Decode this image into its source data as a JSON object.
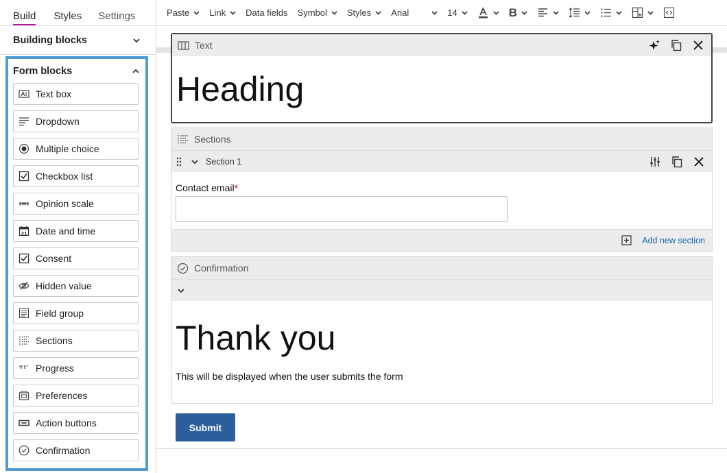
{
  "left_panel": {
    "tabs": [
      {
        "label": "Build",
        "active": true
      },
      {
        "label": "Styles",
        "active": false
      },
      {
        "label": "Settings",
        "active": false
      }
    ],
    "building_blocks": {
      "label": "Building blocks",
      "expanded": false
    },
    "form_blocks": {
      "label": "Form blocks",
      "expanded": true,
      "items": [
        {
          "label": "Text box",
          "icon": "text-box-icon"
        },
        {
          "label": "Dropdown",
          "icon": "dropdown-icon"
        },
        {
          "label": "Multiple choice",
          "icon": "radio-icon"
        },
        {
          "label": "Checkbox list",
          "icon": "checkbox-icon"
        },
        {
          "label": "Opinion scale",
          "icon": "scale-icon"
        },
        {
          "label": "Date and time",
          "icon": "calendar-icon"
        },
        {
          "label": "Consent",
          "icon": "checkbox-icon"
        },
        {
          "label": "Hidden value",
          "icon": "eye-off-icon"
        },
        {
          "label": "Field group",
          "icon": "field-group-icon"
        },
        {
          "label": "Sections",
          "icon": "sections-icon"
        },
        {
          "label": "Progress",
          "icon": "progress-icon"
        },
        {
          "label": "Preferences",
          "icon": "preferences-icon"
        },
        {
          "label": "Action buttons",
          "icon": "button-icon"
        },
        {
          "label": "Confirmation",
          "icon": "check-circle-icon"
        }
      ]
    }
  },
  "toolbar": {
    "paste": "Paste",
    "link": "Link",
    "data_fields": "Data fields",
    "symbol": "Symbol",
    "styles": "Styles",
    "font": "Arial",
    "size": "14"
  },
  "canvas": {
    "text_block": {
      "title": "Text",
      "content": "Heading"
    },
    "sections_block": {
      "title": "Sections",
      "section_name": "Section 1",
      "field_label": "Contact email",
      "required_mark": "*",
      "field_value": "",
      "add_label": "Add new section"
    },
    "confirmation_block": {
      "title": "Confirmation",
      "heading": "Thank you",
      "note": "This will be displayed when the user submits the form"
    },
    "submit_label": "Submit"
  },
  "colors": {
    "active_tab_underline": "#b8169a",
    "form_blocks_outline": "#4f9ad4",
    "submit_bg": "#2d5f9f",
    "link": "#1b64b4",
    "required": "#d0021b"
  }
}
